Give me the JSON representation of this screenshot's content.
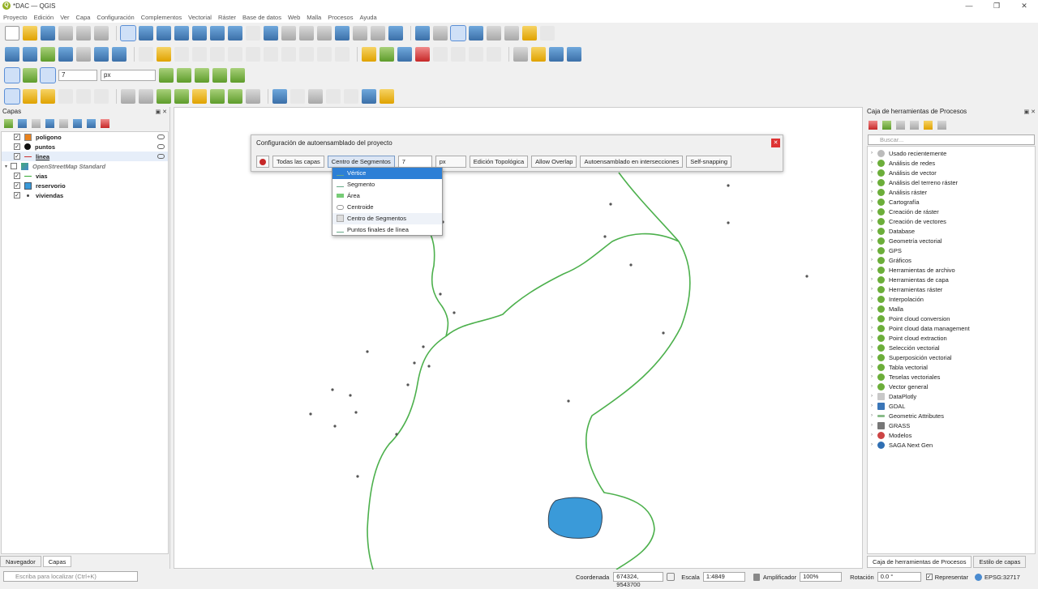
{
  "window": {
    "title": "*DAC — QGIS",
    "controls": [
      "—",
      "❐",
      "✕"
    ]
  },
  "menu": [
    "Proyecto",
    "Edición",
    "Ver",
    "Capa",
    "Configuración",
    "Complementos",
    "Vectorial",
    "Ráster",
    "Base de datos",
    "Web",
    "Malla",
    "Procesos",
    "Ayuda"
  ],
  "snapping_toolbar": {
    "tolerance": "7",
    "units": "px"
  },
  "layers_panel": {
    "title": "Capas",
    "layers": [
      {
        "name": "poligono",
        "checked": true,
        "symbol": "orange-square",
        "bold": true
      },
      {
        "name": "puntos",
        "checked": true,
        "symbol": "black-dot",
        "bold": true
      },
      {
        "name": "linea",
        "checked": true,
        "symbol": "line",
        "bold": true
      },
      {
        "name": "OpenStreetMap Standard",
        "checked": false,
        "symbol": "raster",
        "bold": false
      },
      {
        "name": "vias",
        "checked": true,
        "symbol": "green-line",
        "bold": true
      },
      {
        "name": "reservorio",
        "checked": true,
        "symbol": "blue-square",
        "bold": true
      },
      {
        "name": "viviendas",
        "checked": true,
        "symbol": "dot",
        "bold": true
      }
    ]
  },
  "bottom_tabs": [
    "Navegador",
    "Capas"
  ],
  "dialog": {
    "title": "Configuración de autoensamblado del proyecto",
    "layers_button": "Todas las capas",
    "mode_button": "Centro de Segmentos",
    "tolerance": "7",
    "units": "px",
    "topological": "Edición Topológica",
    "overlap": "Allow Overlap",
    "intersections": "Autoensamblado en intersecciones",
    "self_snapping": "Self-snapping"
  },
  "snap_menu": [
    "Vértice",
    "Segmento",
    "Área",
    "Centroide",
    "Centro de Segmentos",
    "Puntos finales de línea"
  ],
  "processing": {
    "title": "Caja de herramientas de Procesos",
    "search_placeholder": "Buscar...",
    "items": [
      "Usado recientemente",
      "Análisis de redes",
      "Análisis de vector",
      "Análisis del terreno ráster",
      "Análisis ráster",
      "Cartografía",
      "Creación de ráster",
      "Creación de vectores",
      "Database",
      "Geometría vectorial",
      "GPS",
      "Gráficos",
      "Herramientas de archivo",
      "Herramientas de capa",
      "Herramientas ráster",
      "Interpolación",
      "Malla",
      "Point cloud conversion",
      "Point cloud data management",
      "Point cloud extraction",
      "Selección vectorial",
      "Superposición vectorial",
      "Tabla vectorial",
      "Teselas vectoriales",
      "Vector general",
      "DataPlotly",
      "GDAL",
      "Geometric Attributes",
      "GRASS",
      "Modelos",
      "SAGA Next Gen"
    ],
    "tabs": [
      "Caja de herramientas de Procesos",
      "Estilo de capas"
    ]
  },
  "status": {
    "locate_placeholder": "Escriba para localizar (Ctrl+K)",
    "coord_label": "Coordenada",
    "coord": "674324, 9543700",
    "scale_label": "Escala",
    "scale": "1:4849",
    "magnifier_label": "Amplificador",
    "magnifier": "100%",
    "rotation_label": "Rotación",
    "rotation": "0.0 °",
    "render_label": "Representar",
    "crs": "EPSG:32717"
  }
}
